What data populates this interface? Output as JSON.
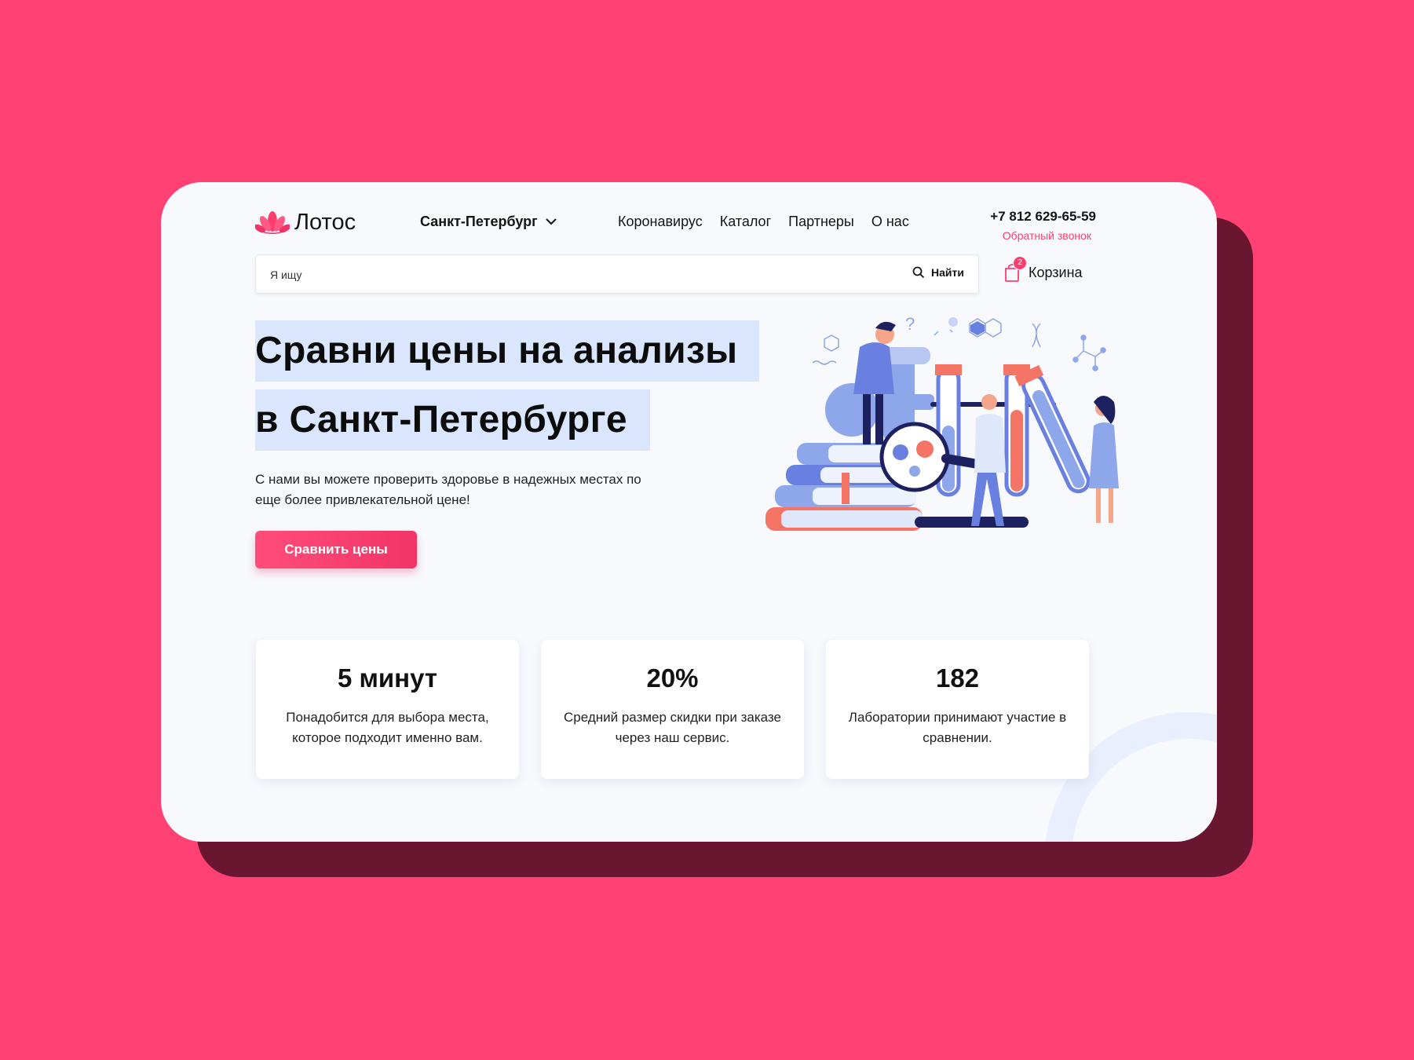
{
  "brand": {
    "name": "Лотос",
    "accent": "#ff3d6e",
    "background": "#ff4273"
  },
  "header": {
    "city": "Санкт-Петербург",
    "nav": [
      "Коронавирус",
      "Каталог",
      "Партнеры",
      "О нас"
    ],
    "phone": "+7 812 629-65-59",
    "callback": "Обратный звонок"
  },
  "search": {
    "placeholder": "Я ищу",
    "button": "Найти"
  },
  "cart": {
    "label": "Корзина",
    "count": "2"
  },
  "hero": {
    "title_line1": "Сравни цены на анализы",
    "title_line2": "в Санкт-Петербурге",
    "description": "С нами вы можете проверить здоровье в надежных местах по еще более привлекательной цене!",
    "cta": "Сравнить цены"
  },
  "stats": [
    {
      "value": "5 минут",
      "text": "Понадобится для выбора места, которое подходит именно вам."
    },
    {
      "value": "20%",
      "text": "Средний размер скидки при заказе через наш сервис."
    },
    {
      "value": "182",
      "text": "Лаборатории принимают участие в сравнении."
    }
  ]
}
